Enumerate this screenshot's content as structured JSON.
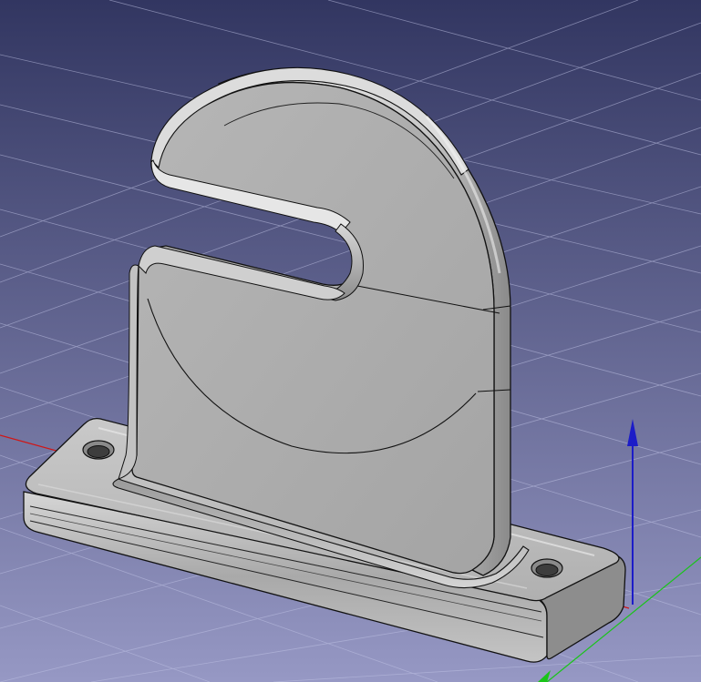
{
  "viewport": {
    "background_top": "#323661",
    "background_bottom": "#9698c4",
    "grid_color": "#bfc2e4",
    "model_face": "#ababab",
    "model_highlight": "#e4e4e4",
    "model_shadow": "#6f6f6f",
    "edge_color": "#111111"
  },
  "axes": {
    "x_color": "#d01616",
    "y_color": "#19c419",
    "z_color": "#1c1cc8"
  },
  "model": {
    "part": "hook-bracket",
    "mounting_holes": 2
  }
}
